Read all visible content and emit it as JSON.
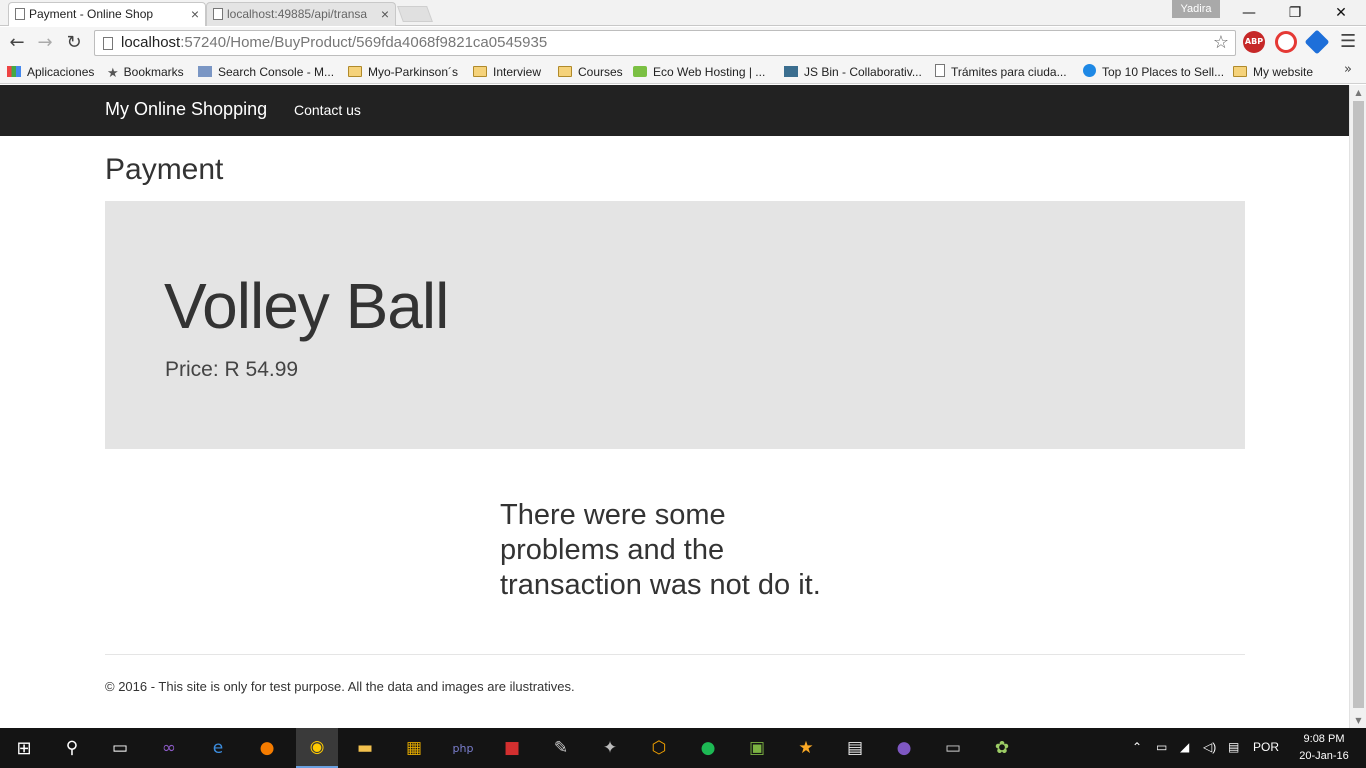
{
  "browser": {
    "tabs": [
      {
        "title": "Payment - Online Shop",
        "active": true
      },
      {
        "title": "localhost:49885/api/transa",
        "active": false
      }
    ],
    "profile_name": "Yadira",
    "url_host": "localhost",
    "url_path": ":57240/Home/BuyProduct/569fda4068f9821ca0545935",
    "bookmarks": [
      {
        "label": "Aplicaciones",
        "icon": "apps-icon"
      },
      {
        "label": "Bookmarks",
        "icon": "star-icon"
      },
      {
        "label": "Search Console - M...",
        "icon": "search-console-icon"
      },
      {
        "label": "Myo-Parkinson´s",
        "icon": "folder-icon"
      },
      {
        "label": "Interview",
        "icon": "folder-icon"
      },
      {
        "label": "Courses",
        "icon": "folder-icon"
      },
      {
        "label": "Eco Web Hosting | ...",
        "icon": "eco-hosting-icon"
      },
      {
        "label": "JS Bin - Collaborativ...",
        "icon": "jsbin-icon"
      },
      {
        "label": "Trámites para ciuda...",
        "icon": "page-icon"
      },
      {
        "label": "Top 10 Places to Sell...",
        "icon": "top10-icon"
      },
      {
        "label": "My website",
        "icon": "folder-icon"
      }
    ],
    "extensions": [
      {
        "name": "abp-icon",
        "text": "ABP",
        "color": "#c62828"
      },
      {
        "name": "opera-red-icon",
        "text": "",
        "color": "#e53935"
      },
      {
        "name": "extension-blue-icon",
        "text": "",
        "color": "#1e6fd9"
      }
    ]
  },
  "site": {
    "brand": "My Online Shopping",
    "nav_links": [
      "Contact us"
    ],
    "page_heading": "Payment",
    "product": {
      "name": "Volley Ball",
      "price_label": "Price:",
      "price_value": "R 54.99"
    },
    "message": "There were some problems and the transaction was not do it.",
    "footer": "© 2016 - This site is only for test purpose. All the data and images are ilustratives."
  },
  "taskbar": {
    "apps": [
      "visual-studio-icon",
      "edge-icon",
      "firefox-icon",
      "chrome-icon",
      "file-explorer-icon",
      "app-grid-icon",
      "php-icon",
      "app-red-icon",
      "app-tool-icon",
      "app-cat-icon",
      "app-orange-icon",
      "spotify-icon",
      "app-green-icon",
      "app-star-icon",
      "calculator-icon",
      "app-purple-icon",
      "terminal-icon",
      "paint-icon"
    ],
    "language": "POR",
    "time": "9:08 PM",
    "date": "20-Jan-16"
  },
  "colors": {
    "navbar_bg": "#222222",
    "jumbotron_bg": "#e4e4e4",
    "taskbar_bg": "#141414"
  }
}
